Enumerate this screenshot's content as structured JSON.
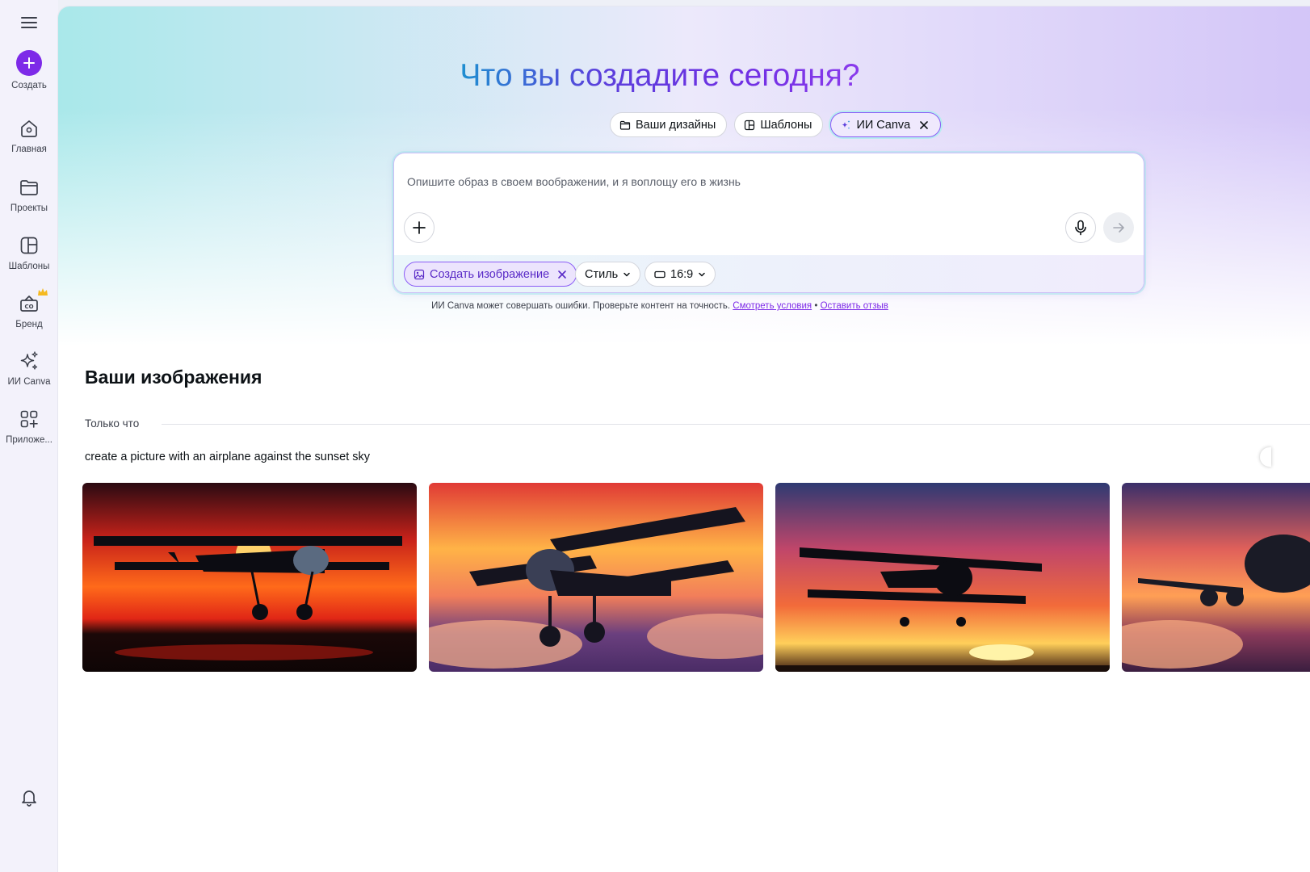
{
  "sidebar": {
    "menu_icon": "hamburger-icon",
    "items": [
      {
        "id": "create",
        "label": "Создать",
        "icon": "plus-icon"
      },
      {
        "id": "home",
        "label": "Главная",
        "icon": "home-icon"
      },
      {
        "id": "projects",
        "label": "Проекты",
        "icon": "folder-icon"
      },
      {
        "id": "templates",
        "label": "Шаблоны",
        "icon": "templates-icon"
      },
      {
        "id": "brand",
        "label": "Бренд",
        "icon": "brand-icon"
      },
      {
        "id": "ai",
        "label": "ИИ Canva",
        "icon": "sparkles-icon"
      },
      {
        "id": "apps",
        "label": "Приложе...",
        "icon": "apps-icon"
      }
    ],
    "notifications_icon": "bell-icon"
  },
  "hero": {
    "title": "Что вы создадите сегодня?",
    "chips": {
      "designs": "Ваши дизайны",
      "templates": "Шаблоны",
      "ai": "ИИ Canva"
    }
  },
  "prompt": {
    "placeholder": "Опишите образ в своем воображении, и я воплощу его в жизнь",
    "create_image": "Создать изображение",
    "style": "Стиль",
    "ratio": "16:9"
  },
  "disclaimer": {
    "text": "ИИ Canva может совершать ошибки. Проверьте контент на точность.",
    "terms_link": "Смотреть условия",
    "separator": "•",
    "feedback_link": "Оставить отзыв"
  },
  "images": {
    "title": "Ваши изображения",
    "group_label": "Только что",
    "prompt_caption": "create a picture with an airplane against the sunset sky",
    "thumbnails": 4
  },
  "colors": {
    "accent": "#7d2ae8",
    "link": "#7d2ae8",
    "text": "#0d1216"
  }
}
